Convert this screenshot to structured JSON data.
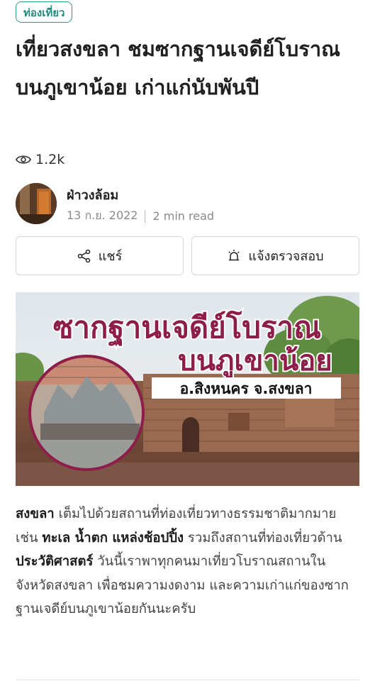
{
  "article": {
    "category": "ท่องเที่ยว",
    "title": "เที่ยวสงขลา ชมซากฐานเจดีย์โบราณบนภูเขาน้อย เก่าแก่นับพันปี",
    "views": "1.2k",
    "author": "ฝ่าวงล้อม",
    "date": "13 ก.ย. 2022",
    "read_time": "2 min read"
  },
  "actions": {
    "share_label": "แชร์",
    "report_label": "แจ้งตรวจสอบ"
  },
  "hero": {
    "line1": "ซากฐานเจดีย์โบราณ",
    "line2": "บนภูเขาน้อย",
    "location": "อ.สิงหนคร จ.สงขลา"
  },
  "body": {
    "p1": "สงขลา",
    "p2": " เต็มไปด้วยสถานที่ท่องเที่ยวทางธรรมชาติมากมาย เช่น ",
    "p3": "ทะเล น้ำตก แหล่งช้อปปิ้ง",
    "p4": " รวมถึงสถานที่ท่องเที่ยวด้าน",
    "p5": "ประวัติศาสตร์",
    "p6": " วันนี้เราพาทุกคนมาเที่ยวโบราณสถานในจังหวัดสงขลา เพื่อชมความงดงาม และความเก่าแก่ของซากฐานเจดีย์บนภูเขาน้อยกันนะครับ"
  },
  "colors": {
    "accent": "#1f8a7c",
    "hero_title": "#8e1d4a",
    "hero_title_outline": "#ffffff"
  },
  "icons": {
    "views": "eye-icon",
    "share": "share-icon",
    "report": "siren-icon"
  }
}
